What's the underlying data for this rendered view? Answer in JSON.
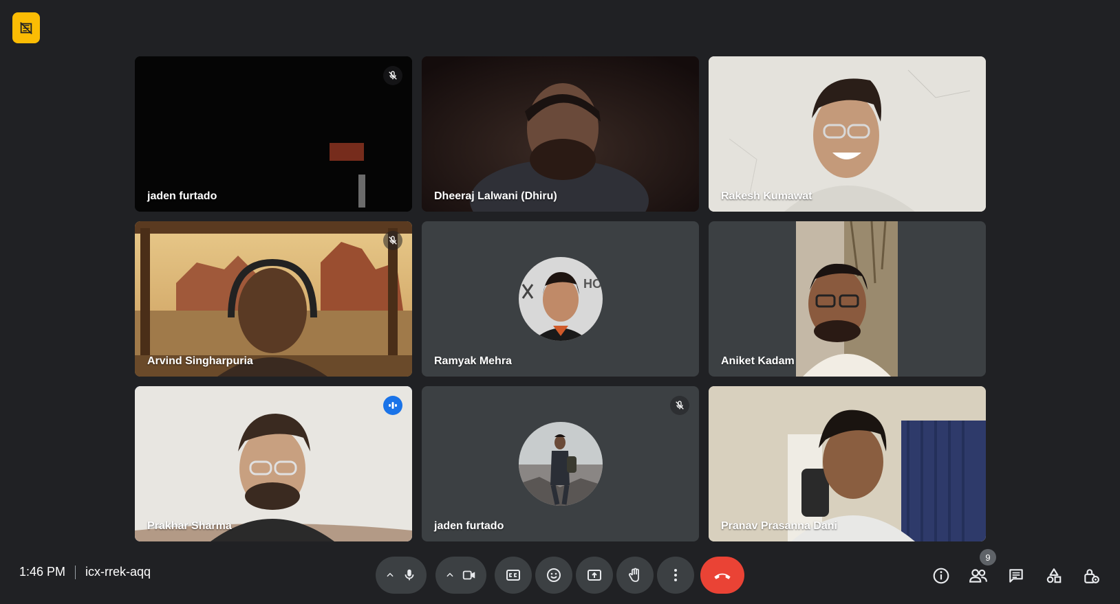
{
  "meeting": {
    "time": "1:46 PM",
    "code": "icx-rrek-aqq"
  },
  "participants": [
    {
      "name": "jaden furtado",
      "muted": true
    },
    {
      "name": "Dheeraj Lalwani (Dhiru)",
      "muted": false
    },
    {
      "name": "Rakesh Kumawat",
      "muted": false
    },
    {
      "name": "Arvind Singharpuria",
      "muted": true
    },
    {
      "name": "Ramyak Mehra",
      "muted": false
    },
    {
      "name": "Aniket Kadam",
      "muted": false
    },
    {
      "name": "Prakhar Sharma",
      "muted": false,
      "speaking": true
    },
    {
      "name": "jaden furtado",
      "muted": true
    },
    {
      "name": "Pranav Prasanna Dani",
      "muted": false
    }
  ],
  "toolbar": {
    "buttons": [
      "mic-button",
      "camera-button",
      "captions-button",
      "emoji-button",
      "present-button",
      "raise-hand-button",
      "more-options-button",
      "leave-call-button"
    ],
    "people_count": "9"
  },
  "colors": {
    "background": "#202124",
    "tile": "#3c4043",
    "accent": "#8ab4f8",
    "hangup": "#ea4335",
    "badge": "#fbbc04"
  }
}
